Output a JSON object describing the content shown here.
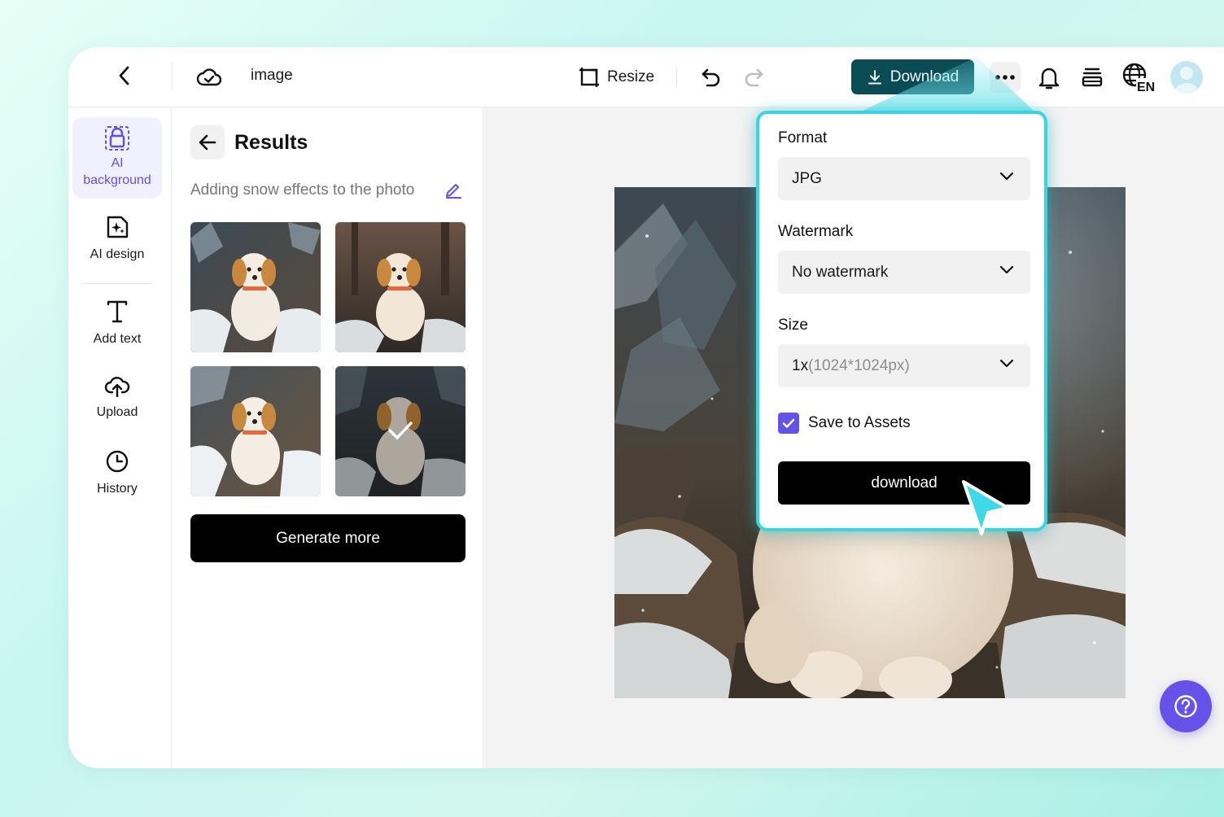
{
  "header": {
    "back_icon": "chevron-left-icon",
    "cloud_icon": "cloud-sync-icon",
    "title": "image",
    "resize_label": "Resize",
    "undo_icon": "undo-icon",
    "redo_icon": "redo-icon",
    "download_label": "Download",
    "more_icon": "more-horizontal-icon",
    "bell_icon": "bell-icon",
    "layers_icon": "layers-icon",
    "lang_icon": "globe-icon",
    "lang_code": "EN",
    "avatar_icon": "avatar-icon"
  },
  "sidebar": {
    "items": [
      {
        "label": "AI\nbackground",
        "line1": "AI",
        "line2": "background",
        "icon": "ai-background-icon",
        "active": true
      },
      {
        "label": "AI design",
        "icon": "ai-design-icon",
        "active": false
      },
      {
        "label": "Add text",
        "icon": "text-icon",
        "active": false
      },
      {
        "label": "Upload",
        "icon": "upload-cloud-icon",
        "active": false
      },
      {
        "label": "History",
        "icon": "clock-icon",
        "active": false
      }
    ]
  },
  "panel": {
    "title": "Results",
    "prompt": "Adding snow effects to the photo",
    "edit_icon": "pencil-icon",
    "results": [
      {
        "name": "result-1",
        "selected": false
      },
      {
        "name": "result-2",
        "selected": false
      },
      {
        "name": "result-3",
        "selected": false
      },
      {
        "name": "result-4",
        "selected": true
      }
    ],
    "generate_more_label": "Generate more"
  },
  "download_popup": {
    "format_label": "Format",
    "format_value": "JPG",
    "watermark_label": "Watermark",
    "watermark_value": "No watermark",
    "size_label": "Size",
    "size_value_main": "1x",
    "size_value_detail": "(1024*1024px)",
    "save_to_assets_label": "Save to Assets",
    "save_to_assets_checked": true,
    "download_button_label": "download"
  },
  "help": {
    "icon": "question-icon"
  },
  "colors": {
    "accent_purple": "#6352e8",
    "download_button_bg": "#0b4b54",
    "popup_border": "#37d6e2",
    "primary_button": "#000000"
  }
}
